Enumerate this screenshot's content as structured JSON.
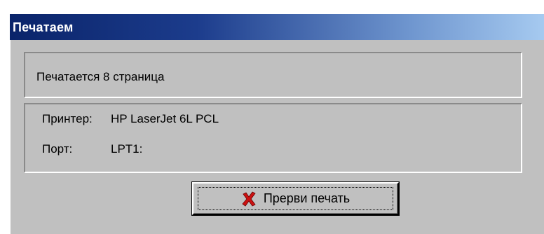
{
  "window": {
    "title": "Печатаем"
  },
  "status": {
    "text": "Печатается 8 страница"
  },
  "info": {
    "printer_label": "Принтер:",
    "printer_value": "HP LaserJet 6L PCL",
    "port_label": "Порт:",
    "port_value": "LPT1:"
  },
  "cancel_button": {
    "label": "Прерви печать",
    "icon": "close-x-icon",
    "icon_color": "#cc1111"
  },
  "colors": {
    "titlebar_start": "#0a246a",
    "titlebar_end": "#a6caf0",
    "face": "#c0c0c0"
  }
}
